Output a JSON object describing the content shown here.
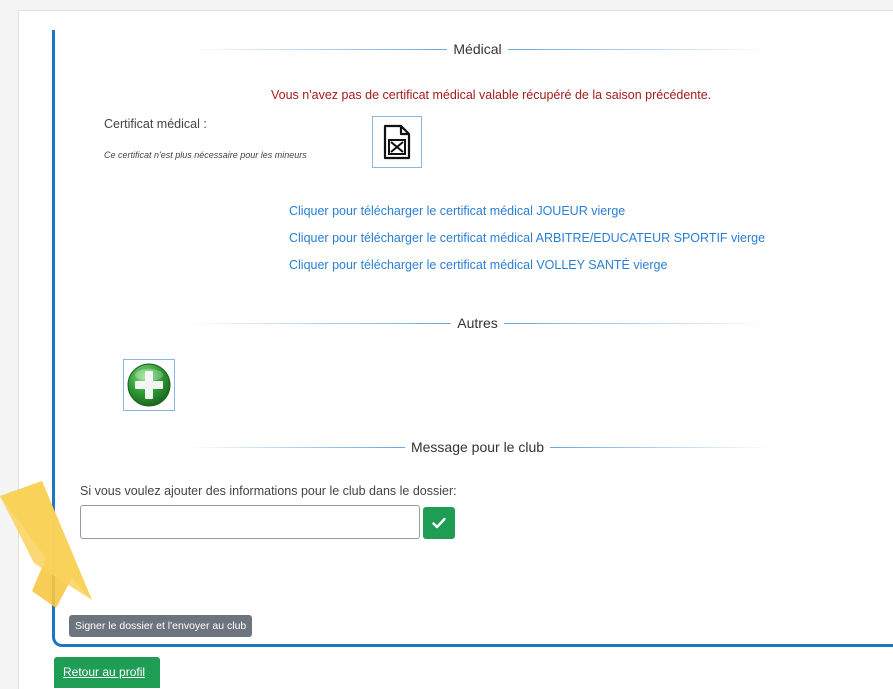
{
  "sections": {
    "medical_label": "Médical",
    "autres_label": "Autres",
    "message_label": "Message pour le club"
  },
  "medical": {
    "warning": "Vous n'avez pas de certificat médical valable récupéré de la saison précédente.",
    "certificate_label": "Certificat médical :",
    "certificate_note": "Ce certificat n'est plus nécessaire pour les mineurs",
    "links": [
      "Cliquer pour télécharger le certificat médical JOUEUR vierge",
      "Cliquer pour télécharger le certificat médical ARBITRE/EDUCATEUR SPORTIF vierge",
      "Cliquer pour télécharger le certificat médical VOLLEY SANTÉ vierge"
    ]
  },
  "message": {
    "prompt": "Si vous voulez ajouter des informations pour le club dans le dossier:",
    "value": ""
  },
  "buttons": {
    "sign": "Signer le dossier et l'envoyer au club",
    "back": "Retour au profil"
  },
  "icons": {
    "file": "file-missing-icon",
    "add": "add-plus-icon",
    "check": "check-icon",
    "arrow": "highlight-arrow"
  },
  "colors": {
    "panel_border": "#1f74c4",
    "warning": "#a31b1b",
    "link": "#2a7fd4",
    "success": "#1f9d55",
    "secondary": "#6c757d",
    "highlight": "#f7c843"
  }
}
